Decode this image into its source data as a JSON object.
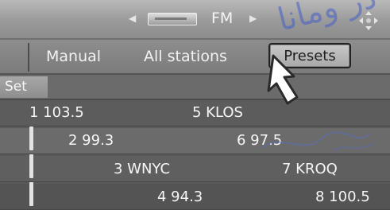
{
  "header": {
    "band": "FM",
    "watermark": "ﺩﺭ ﻭﻣﺎﻧﺎ"
  },
  "menu": {
    "manual_label": "Manual",
    "all_stations_label": "All stations",
    "presets_label": "Presets"
  },
  "set_label": "Set",
  "presets": [
    {
      "label": "1 103.5"
    },
    {
      "label": "2 99.3"
    },
    {
      "label": "3 WNYC"
    },
    {
      "label": "4 94.3"
    },
    {
      "label": "5 KLOS"
    },
    {
      "label": "6 97.5"
    },
    {
      "label": "7 KROQ"
    },
    {
      "label": "8 100.5"
    }
  ],
  "colors": {
    "presets_highlight": "#b8b8b8",
    "pointer": "#ffffff",
    "watermark": "#4a64cc"
  },
  "icons": {
    "left": "left-arrow-icon",
    "right": "right-arrow-icon",
    "dpad": "dpad-icon",
    "pointer": "hand-pointer-icon"
  }
}
